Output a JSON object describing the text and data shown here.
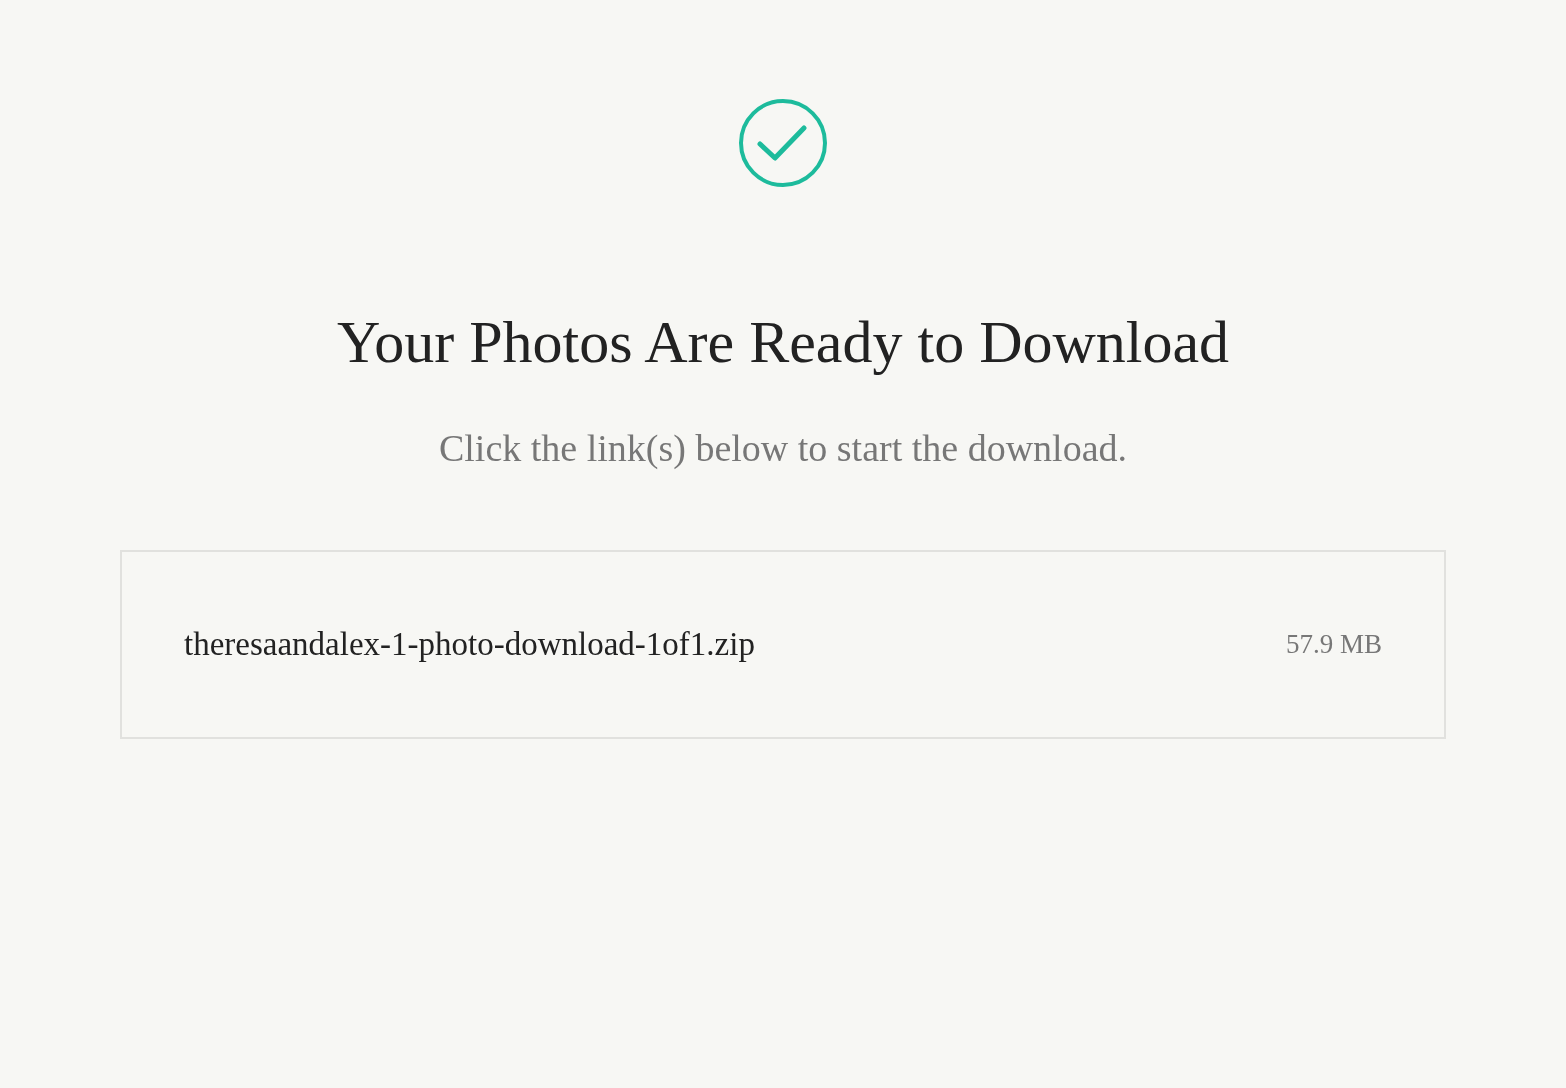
{
  "status": {
    "kind": "success"
  },
  "title": "Your Photos Are Ready to Download",
  "subtitle": "Click the link(s) below to start the download.",
  "downloads": [
    {
      "file": "theresaandalex-1-photo-download-1of1.zip",
      "size": "57.9 MB"
    }
  ]
}
